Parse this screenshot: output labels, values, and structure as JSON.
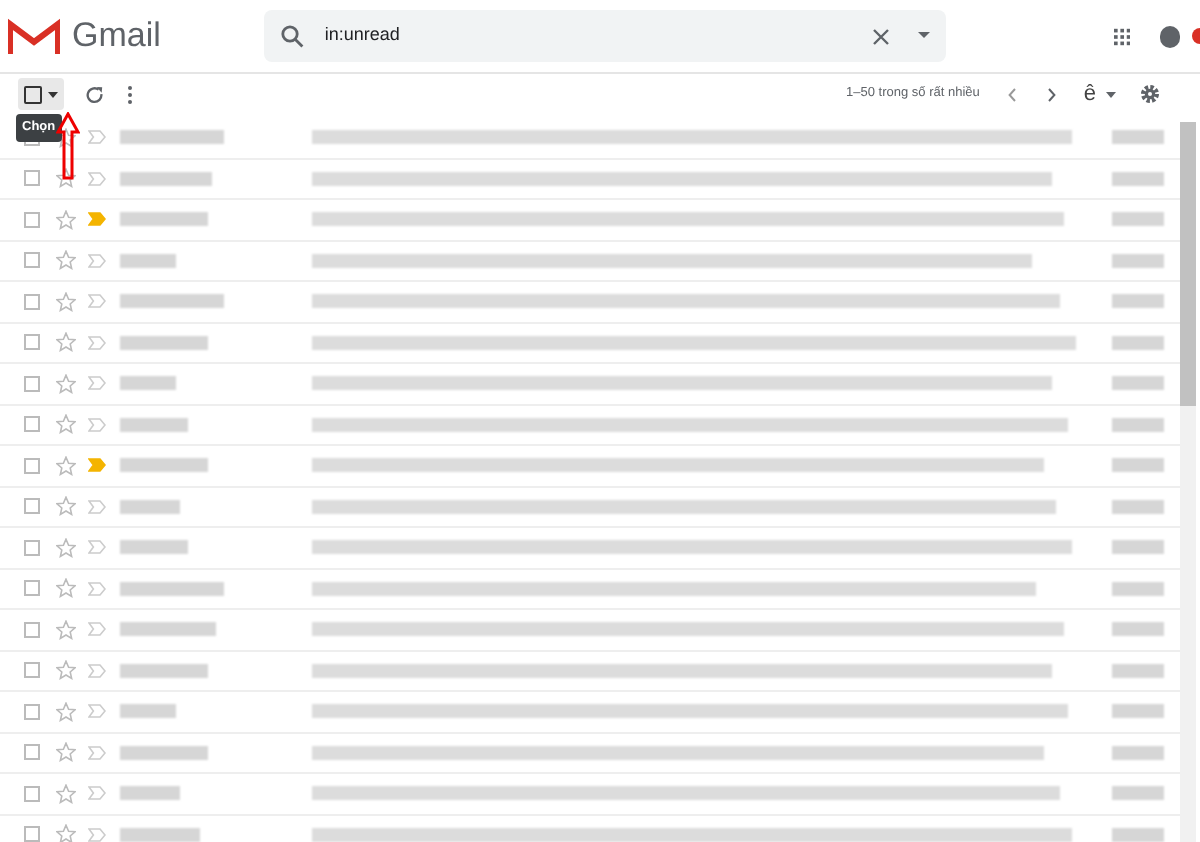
{
  "header": {
    "app_name": "Gmail",
    "search": {
      "value": "in:unread"
    }
  },
  "toolbar": {
    "select_tooltip": "Chọn",
    "pagination": "1–50 trong số rất nhiều",
    "input_tool": "ê"
  },
  "rows": [
    {
      "checked": false,
      "starred": false,
      "important": false
    },
    {
      "checked": false,
      "starred": false,
      "important": false
    },
    {
      "checked": false,
      "starred": false,
      "important": true
    },
    {
      "checked": false,
      "starred": false,
      "important": false
    },
    {
      "checked": false,
      "starred": false,
      "important": false
    },
    {
      "checked": false,
      "starred": false,
      "important": false
    },
    {
      "checked": false,
      "starred": false,
      "important": false
    },
    {
      "checked": false,
      "starred": false,
      "important": false
    },
    {
      "checked": false,
      "starred": false,
      "important": true
    },
    {
      "checked": false,
      "starred": false,
      "important": false
    },
    {
      "checked": false,
      "starred": false,
      "important": false
    },
    {
      "checked": false,
      "starred": false,
      "important": false
    },
    {
      "checked": false,
      "starred": false,
      "important": false
    },
    {
      "checked": false,
      "starred": false,
      "important": false
    },
    {
      "checked": false,
      "starred": false,
      "important": false
    },
    {
      "checked": false,
      "starred": false,
      "important": false
    },
    {
      "checked": false,
      "starred": false,
      "important": false
    },
    {
      "checked": false,
      "starred": false,
      "important": false
    }
  ]
}
